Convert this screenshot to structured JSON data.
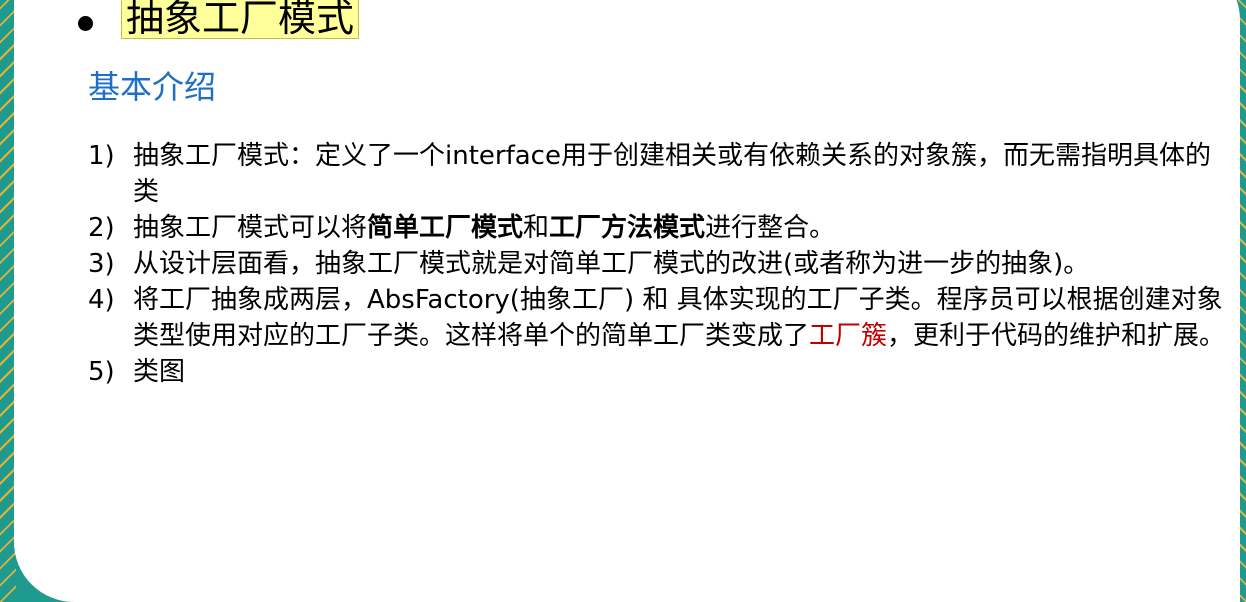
{
  "slide": {
    "title": "抽象工厂模式",
    "subtitle": "基本介绍",
    "items": [
      {
        "num": "1)",
        "text": "抽象工厂模式：定义了一个interface用于创建相关或有依赖关系的对象簇，而无需指明具体的类"
      },
      {
        "num": "2)",
        "pre": "抽象工厂模式可以将",
        "bold1": "简单工厂模式",
        "mid": "和",
        "bold2": "工厂方法模式",
        "post": "进行整合。"
      },
      {
        "num": "3)",
        "text": "从设计层面看，抽象工厂模式就是对简单工厂模式的改进(或者称为进一步的抽象)。"
      },
      {
        "num": "4)",
        "pre": "将工厂抽象成两层，AbsFactory(抽象工厂) 和 具体实现的工厂子类。程序员可以根据创建对象类型使用对应的工厂子类。这样将单个的简单工厂类变成了",
        "red": "工厂簇",
        "post": "，更利于代码的维护和扩展。"
      },
      {
        "num": "5)",
        "text": "类图"
      }
    ]
  },
  "colors": {
    "subtitle": "#1f6fc4",
    "highlight": "#ffff99",
    "emphasis_red": "#c00000",
    "frame": "#1f9a8e"
  }
}
